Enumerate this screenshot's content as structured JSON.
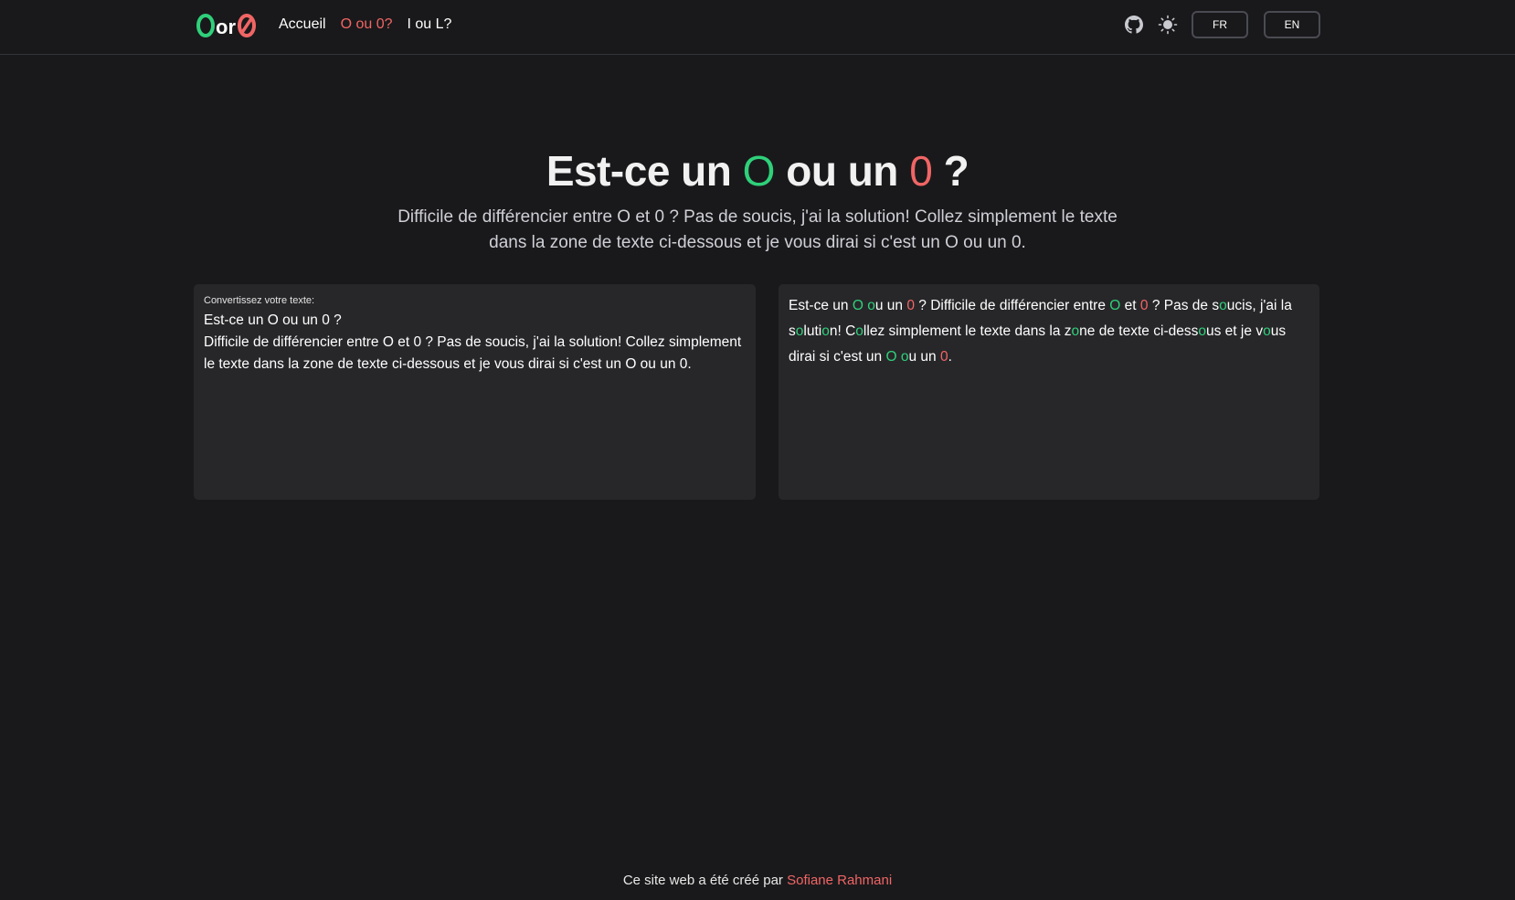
{
  "nav": {
    "logo": {
      "o": "O",
      "or": "or",
      "zero": "0"
    },
    "links": [
      {
        "label": "Accueil"
      },
      {
        "label": "O ou 0?"
      },
      {
        "label": "I ou L?"
      }
    ],
    "icons": [
      "github-icon",
      "sun-icon"
    ],
    "languages": [
      "FR",
      "EN"
    ]
  },
  "hero": {
    "title_prefix": "Est-ce un",
    "title_o": "O",
    "title_middle": "ou un",
    "title_zero": "0",
    "title_suffix": "?",
    "subtitle": "Difficile de différencier entre O et 0 ? Pas de soucis, j'ai la solution! Collez simplement le texte dans la zone de texte ci-dessous et je vous dirai si c'est un O ou un 0."
  },
  "input_panel": {
    "label": "Convertissez votre texte:",
    "value": "Est-ce un O ou un 0 ?\nDifficile de différencier entre O et 0 ? Pas de soucis, j'ai la solution! Collez simplement le texte dans la zone de texte ci-dessous et je vous dirai si c'est un O ou un 0."
  },
  "output_panel": {
    "text": "Est-ce un O ou un 0 ? Difficile de différencier entre O et 0 ? Pas de soucis, j'ai la solution! Collez simplement le texte dans la zone de texte ci-dessous et je vous dirai si c'est un O ou un 0."
  },
  "footer": {
    "text": "Ce site web a été créé par",
    "author": "Sofiane Rahmani"
  },
  "colors": {
    "background": "#19191b",
    "panel": "#27272a",
    "letter_o": "#2fd07a",
    "digit_zero": "#f16565",
    "active_link": "#f16565"
  }
}
